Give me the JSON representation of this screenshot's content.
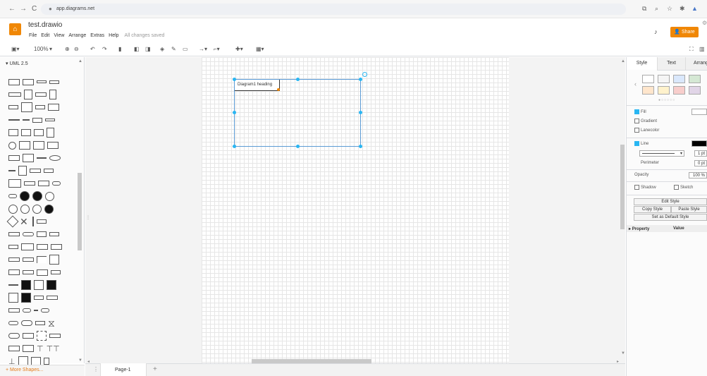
{
  "browser": {
    "back": "←",
    "forward": "→",
    "reload": "C",
    "lock": "🔒",
    "url": "app.diagrams.net"
  },
  "app": {
    "title": "test.drawio",
    "menu": [
      "File",
      "Edit",
      "View",
      "Arrange",
      "Extras",
      "Help"
    ],
    "status": "All changes saved",
    "share_label": "Share",
    "accent": "#f08705"
  },
  "toolbar": {
    "zoom": "100%"
  },
  "left_panel": {
    "library": "UML 2.5",
    "more_shapes": "+ More Shapes..."
  },
  "canvas": {
    "frame_label": "Diagram1 heading",
    "selection_color": "#29b6f2"
  },
  "pages": {
    "active": "Page-1",
    "add": "+"
  },
  "format_panel": {
    "tabs": [
      "Style",
      "Text",
      "Arrange"
    ],
    "fill_label": "Fill",
    "gradient_label": "Gradient",
    "lanecolor_label": "Lanecolor",
    "line_label": "Line",
    "line_width": "1 pt",
    "perimeter_label": "Perimeter",
    "perimeter_value": "0 pt",
    "opacity_label": "Opacity",
    "opacity_value": "100 %",
    "shadow_label": "Shadow",
    "sketch_label": "Sketch",
    "edit_style": "Edit Style",
    "copy_style": "Copy Style",
    "paste_style": "Paste Style",
    "default_style": "Set as Default Style",
    "property_header": "Property",
    "value_header": "Value",
    "swatches_row1": [
      "#ffffff",
      "#f5f5f5",
      "#dae8fc",
      "#d5e8d4"
    ],
    "swatches_row2": [
      "#ffe6cc",
      "#fff2cc",
      "#f8cecc",
      "#e1d5e7"
    ]
  }
}
